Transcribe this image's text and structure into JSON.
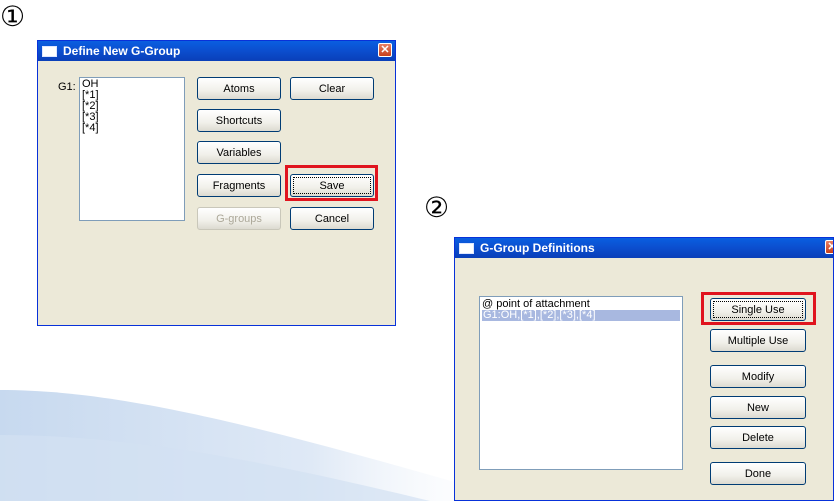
{
  "steps": {
    "first": "①",
    "second": "②"
  },
  "define_dialog": {
    "title": "Define New G-Group",
    "close_glyph": "✕",
    "group_label": "G1:",
    "list_items": [
      "OH",
      "[*1]",
      "[*2]",
      "[*3]",
      "[*4]"
    ],
    "buttons": {
      "atoms": "Atoms",
      "clear": "Clear",
      "shortcuts": "Shortcuts",
      "variables": "Variables",
      "fragments": "Fragments",
      "save": "Save",
      "g_groups": "G-groups",
      "cancel": "Cancel"
    }
  },
  "definitions_dialog": {
    "title": "G-Group Definitions",
    "close_glyph": "✕",
    "list_items": [
      "@ point of attachment",
      "G1:OH,[*1],[*2],[*3],[*4]"
    ],
    "buttons": {
      "single_use": "Single Use",
      "multiple_use": "Multiple Use",
      "modify": "Modify",
      "new": "New",
      "delete": "Delete",
      "done": "Done"
    }
  },
  "colors": {
    "highlight": "#e0141e",
    "titlebar": "#0a5fe0",
    "dialog_bg": "#ece9d8"
  }
}
